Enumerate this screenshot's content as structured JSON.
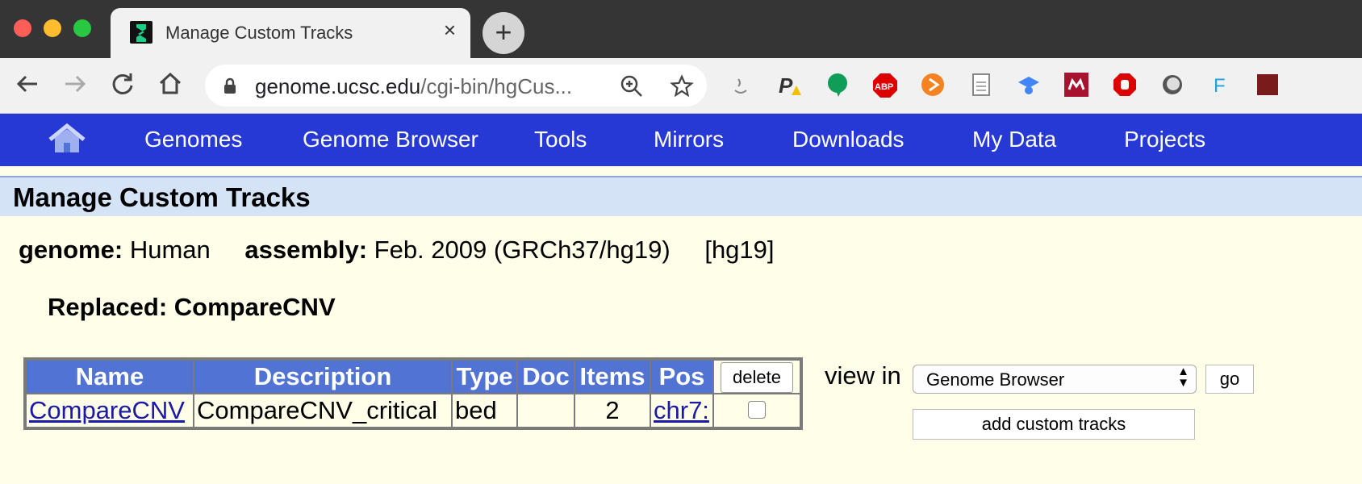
{
  "browser": {
    "tab_title": "Manage Custom Tracks",
    "tab_close": "×",
    "new_tab": "+",
    "url_host": "genome.ucsc.edu",
    "url_path": "/cgi-bin/hgCus..."
  },
  "nav": {
    "items": [
      "Genomes",
      "Genome Browser",
      "Tools",
      "Mirrors",
      "Downloads",
      "My Data",
      "Projects"
    ]
  },
  "page": {
    "title": "Manage Custom Tracks",
    "genome_label": "genome:",
    "genome_value": "Human",
    "assembly_label": "assembly:",
    "assembly_value": "Feb. 2009 (GRCh37/hg19)",
    "db": "[hg19]",
    "replaced_label": "Replaced:",
    "replaced_value": "CompareCNV"
  },
  "table": {
    "headers": [
      "Name",
      "Description",
      "Type",
      "Doc",
      "Items",
      "Pos"
    ],
    "delete_label": "delete",
    "rows": [
      {
        "name": "CompareCNV",
        "description": "CompareCNV_critical",
        "type": "bed",
        "doc": "",
        "items": "2",
        "pos": "chr7:"
      }
    ]
  },
  "controls": {
    "view_in_label": "view in",
    "select_value": "Genome Browser",
    "go_label": "go",
    "add_label": "add custom tracks"
  },
  "colors": {
    "nav_bg": "#2639d4",
    "header_bg": "#5173d4",
    "page_bg": "#fffee8",
    "title_bar_bg": "#d5e3f7",
    "link": "#1a1aa6"
  }
}
